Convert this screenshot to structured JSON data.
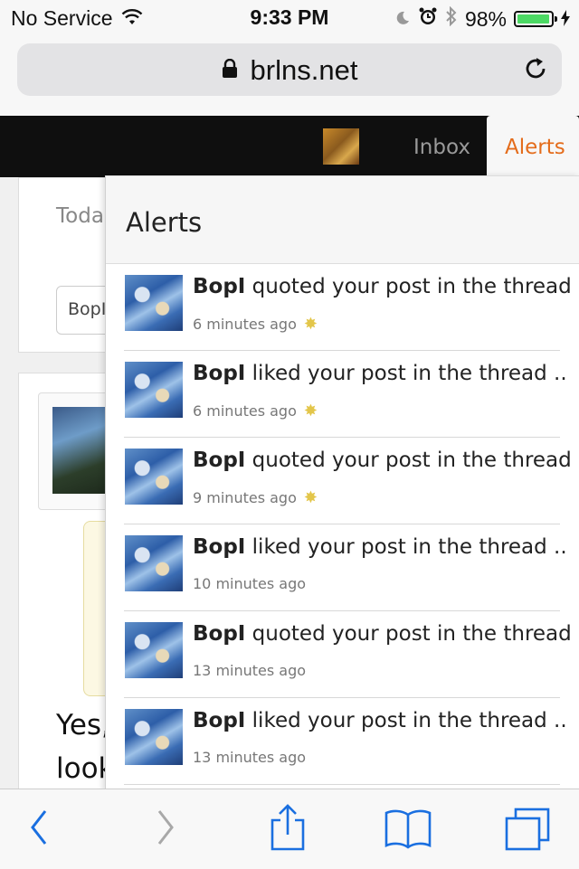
{
  "status_bar": {
    "carrier": "No Service",
    "time": "9:33 PM",
    "battery": "98%",
    "battery_level": 0.98
  },
  "address_bar": {
    "url": "brlns.net"
  },
  "site_nav": {
    "inbox_label": "Inbox",
    "alerts_label": "Alerts"
  },
  "background_page": {
    "today_text": "Toda",
    "input_value": "BopI",
    "body_text_line1": "Yes,",
    "body_text_line2": "look"
  },
  "alerts_panel": {
    "title": "Alerts",
    "items": [
      {
        "user": "BopI",
        "action": " quoted your post in the thread ..",
        "time": "6 minutes ago",
        "new": true
      },
      {
        "user": "BopI",
        "action": " liked your post in the thread ..",
        "time": "6 minutes ago",
        "new": true
      },
      {
        "user": "BopI",
        "action": " quoted your post in the thread ..",
        "time": "9 minutes ago",
        "new": true
      },
      {
        "user": "BopI",
        "action": " liked your post in the thread ..",
        "time": "10 minutes ago",
        "new": false
      },
      {
        "user": "BopI",
        "action": " quoted your post in the thread ..",
        "time": "13 minutes ago",
        "new": false
      },
      {
        "user": "BopI",
        "action": " liked your post in the thread ..",
        "time": "13 minutes ago",
        "new": false
      }
    ]
  },
  "colors": {
    "accent": "#e46c1b",
    "nav_bg": "#0f0f0f",
    "ios_blue": "#1a6fe0"
  }
}
